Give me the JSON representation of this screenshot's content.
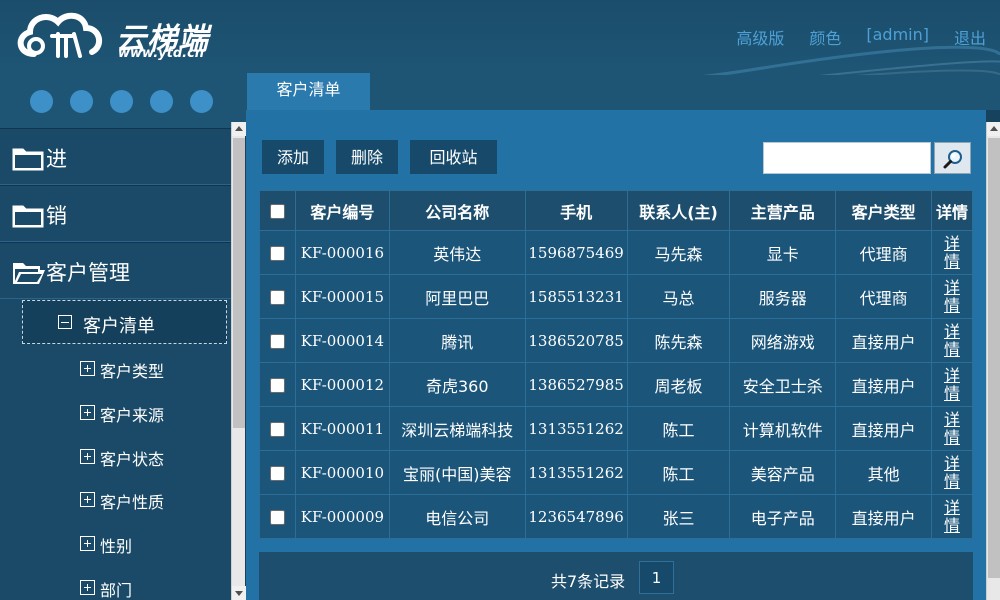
{
  "logo": {
    "name": "云梯端",
    "url": "www.ytd.cn"
  },
  "topnav": {
    "advanced": "高级版",
    "color": "颜色",
    "user": "[admin]",
    "logout": "退出"
  },
  "sidebar": {
    "groups": [
      {
        "label": "进"
      },
      {
        "label": "销"
      },
      {
        "label": "客户管理"
      }
    ],
    "selected": "客户清单",
    "items": [
      {
        "label": "客户类型"
      },
      {
        "label": "客户来源"
      },
      {
        "label": "客户状态"
      },
      {
        "label": "客户性质"
      },
      {
        "label": "性别"
      },
      {
        "label": "部门"
      }
    ]
  },
  "tab": {
    "label": "客户清单"
  },
  "toolbar": {
    "add": "添加",
    "delete": "删除",
    "recycle": "回收站",
    "search_value": ""
  },
  "table": {
    "headers": [
      "客户编号",
      "公司名称",
      "手机",
      "联系人(主)",
      "主营产品",
      "客户类型",
      "详情"
    ],
    "rows": [
      {
        "id": "KF-000016",
        "company": "英伟达",
        "phone": "1596875469",
        "contact": "马先森",
        "product": "显卡",
        "type": "代理商",
        "detail": "详情"
      },
      {
        "id": "KF-000015",
        "company": "阿里巴巴",
        "phone": "1585513231",
        "contact": "马总",
        "product": "服务器",
        "type": "代理商",
        "detail": "详情"
      },
      {
        "id": "KF-000014",
        "company": "腾讯",
        "phone": "1386520785",
        "contact": "陈先森",
        "product": "网络游戏",
        "type": "直接用户",
        "detail": "详情"
      },
      {
        "id": "KF-000012",
        "company": "奇虎360",
        "phone": "1386527985",
        "contact": "周老板",
        "product": "安全卫士杀",
        "type": "直接用户",
        "detail": "详情"
      },
      {
        "id": "KF-000011",
        "company": "深圳云梯端科技",
        "phone": "1313551262",
        "contact": "陈工",
        "product": "计算机软件",
        "type": "直接用户",
        "detail": "详情"
      },
      {
        "id": "KF-000010",
        "company": "宝丽(中国)美容",
        "phone": "1313551262",
        "contact": "陈工",
        "product": "美容产品",
        "type": "其他",
        "detail": "详情"
      },
      {
        "id": "KF-000009",
        "company": "电信公司",
        "phone": "1236547896",
        "contact": "张三",
        "product": "电子产品",
        "type": "直接用户",
        "detail": "详情"
      }
    ]
  },
  "pagination": {
    "records": "共7条记录",
    "page": "1"
  },
  "colors": {
    "accent": "#4ea0d6",
    "panel": "#2372a5",
    "sidebar": "#1a4a67",
    "header": "#1e5575"
  }
}
